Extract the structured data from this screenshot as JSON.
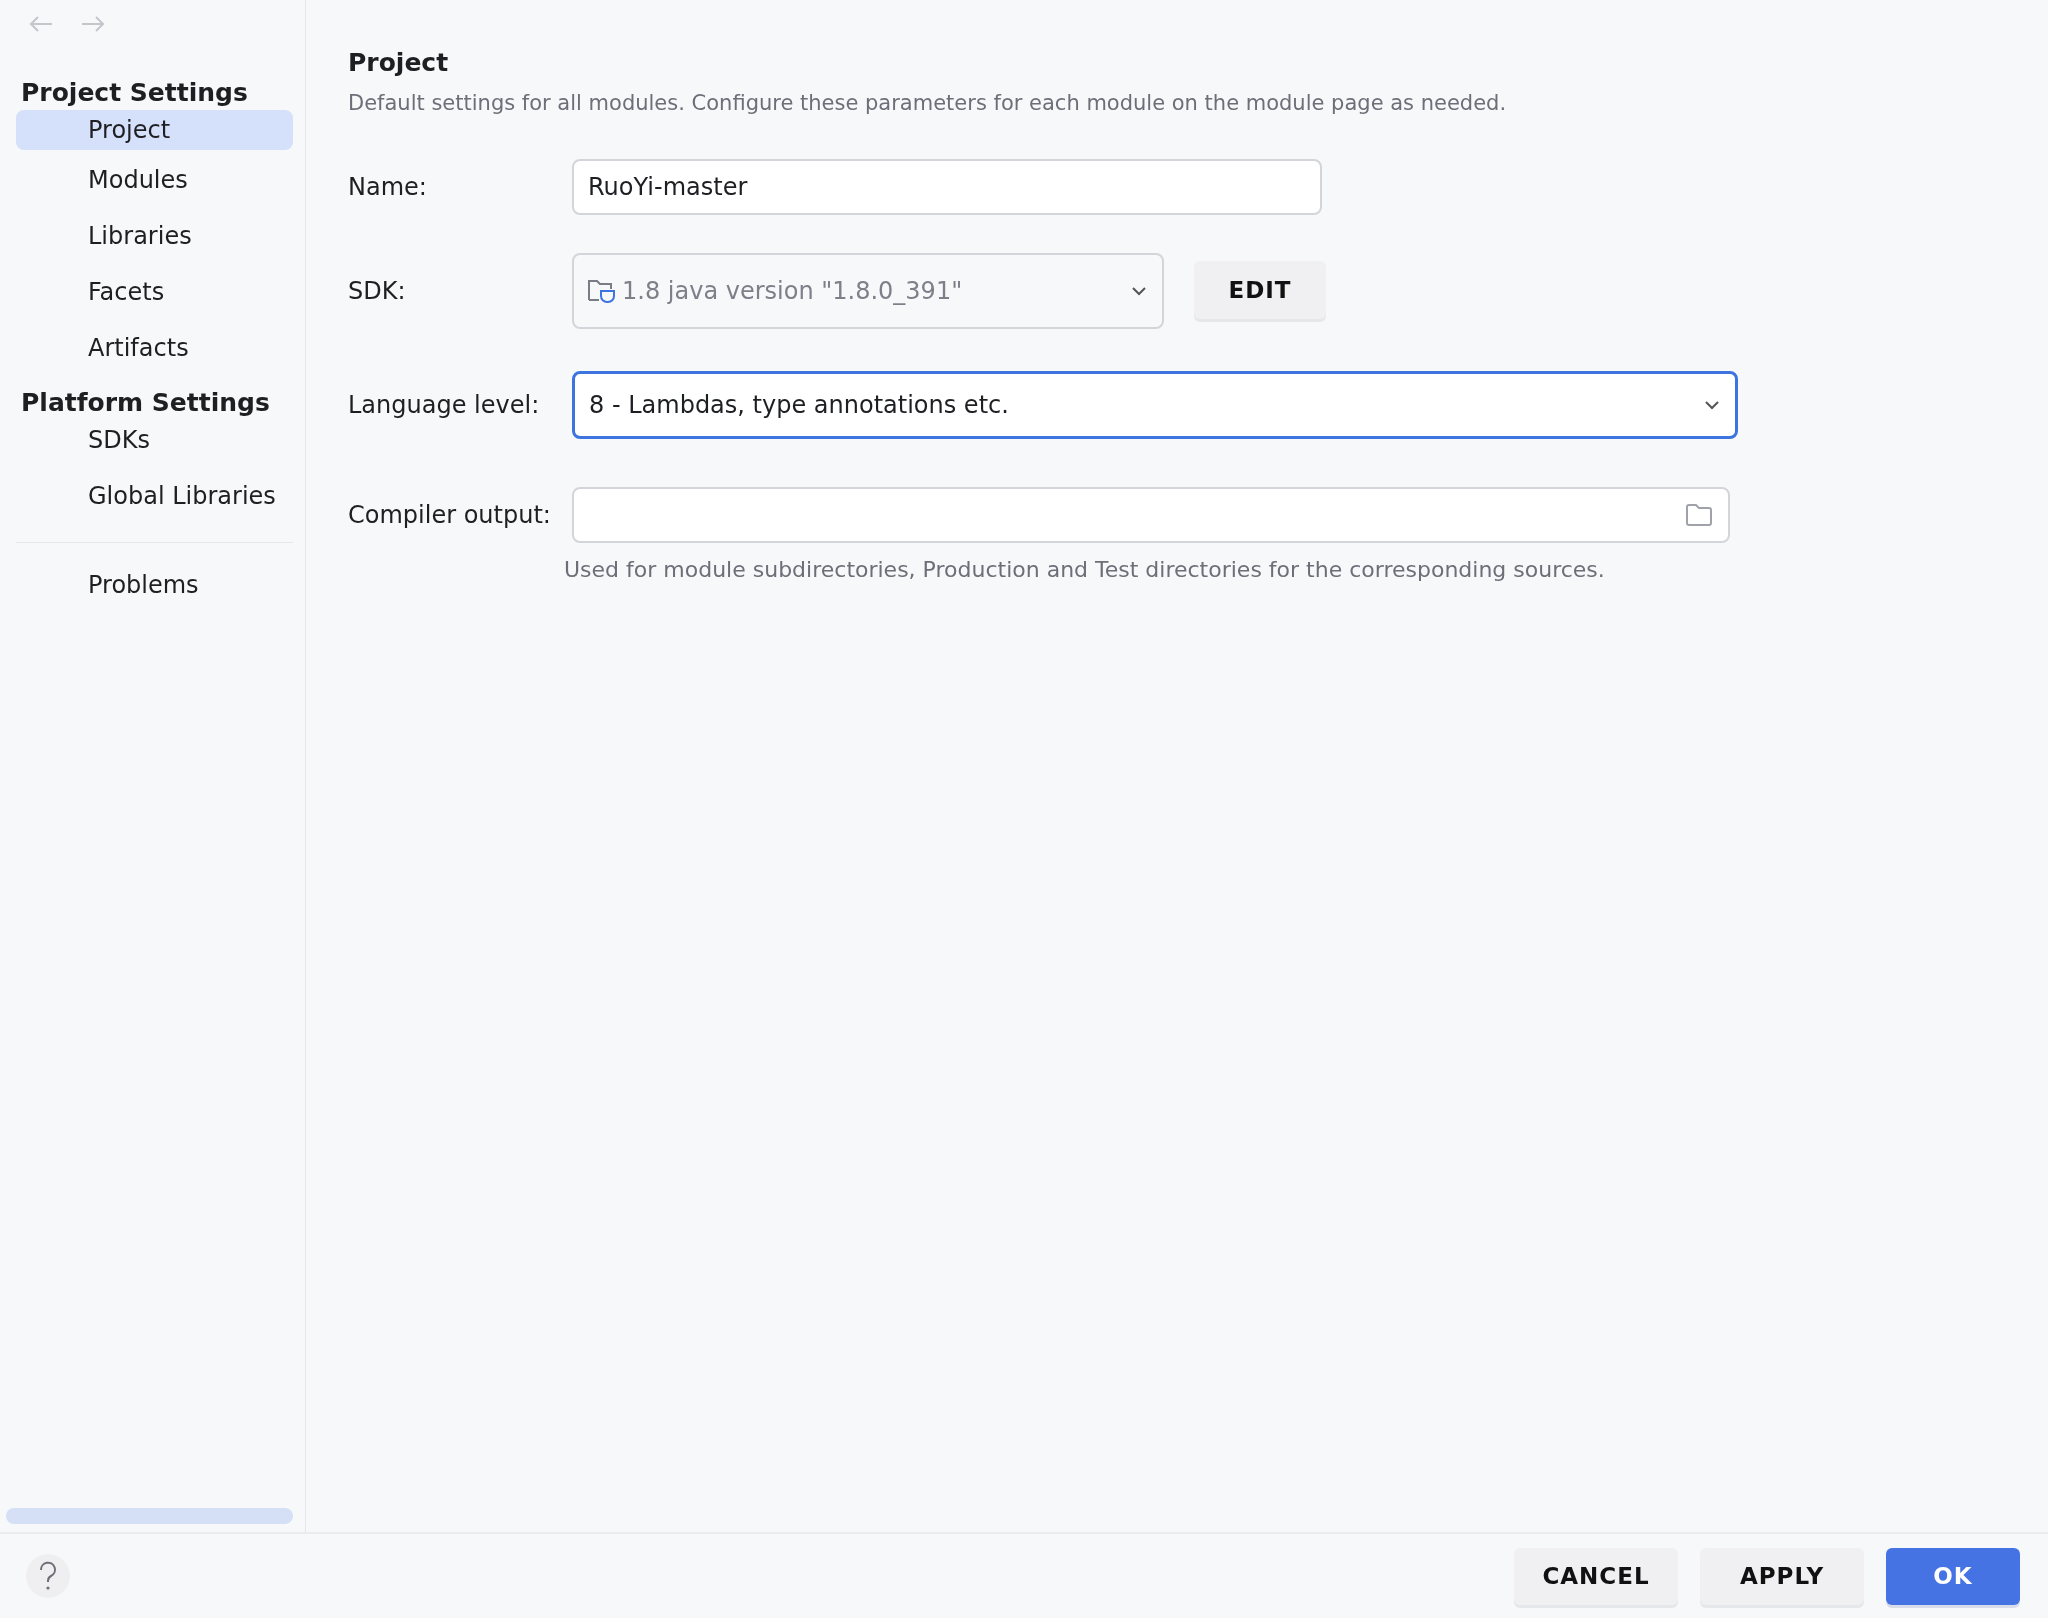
{
  "sidebar": {
    "sections": [
      {
        "title": "Project Settings",
        "items": [
          {
            "label": "Project",
            "selected": true
          },
          {
            "label": "Modules",
            "selected": false
          },
          {
            "label": "Libraries",
            "selected": false
          },
          {
            "label": "Facets",
            "selected": false
          },
          {
            "label": "Artifacts",
            "selected": false
          }
        ]
      },
      {
        "title": "Platform Settings",
        "items": [
          {
            "label": "SDKs",
            "selected": false
          },
          {
            "label": "Global Libraries",
            "selected": false
          }
        ]
      }
    ],
    "extra_items": [
      {
        "label": "Problems",
        "selected": false
      }
    ]
  },
  "content": {
    "title": "Project",
    "description": "Default settings for all modules. Configure these parameters for each module on the module page as needed.",
    "fields": [
      {
        "kind": "text",
        "label": "Name:",
        "value": "RuoYi-master",
        "focused": false
      },
      {
        "kind": "sdk",
        "label": "SDK:",
        "value": "1.8 java version \"1.8.0_391\"",
        "button": "EDIT",
        "focused": false
      },
      {
        "kind": "select",
        "label": "Language level:",
        "value": "8 - Lambdas, type annotations etc.",
        "focused": true
      },
      {
        "kind": "path",
        "label": "Compiler output:",
        "focused": false,
        "hint": "Used for module subdirectories, Production and Test directories for the corresponding sources."
      }
    ]
  },
  "buttons": [
    {
      "label": "CANCEL",
      "primary": false
    },
    {
      "label": "APPLY",
      "primary": false
    },
    {
      "label": "OK",
      "primary": true
    }
  ]
}
